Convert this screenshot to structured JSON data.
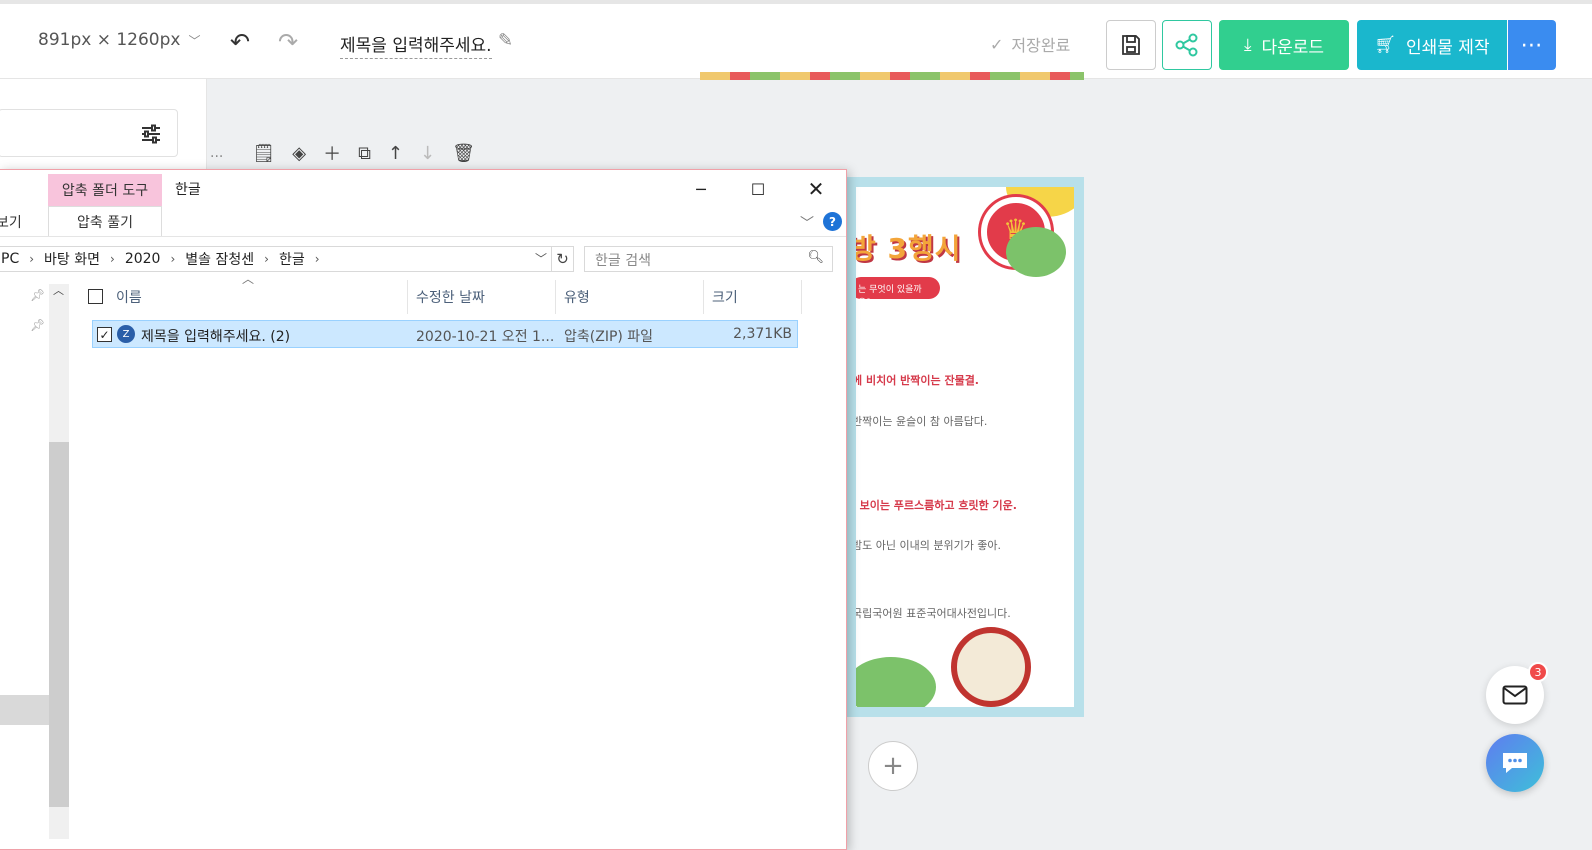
{
  "topbar": {
    "size_label": "891px × 1260px",
    "doc_title": "제목을 입력해주세요.",
    "save_status": "저장완료",
    "download_label": "다운로드",
    "print_label": "인쇄물 제작",
    "more_label": "⋯"
  },
  "canvas": {
    "toolbar_more": "...",
    "poster": {
      "title": "방 3행시",
      "tag": "는 무엇이 있을까요? ▸",
      "lines": [
        {
          "text": "에 비치어 반짝이는 잔물결.",
          "style": "red"
        },
        {
          "text": "반짝이는 윤슬이 참 아름답다.",
          "style": "gray"
        },
        {
          "text": "l 보이는 푸르스름하고 흐릿한 기운.",
          "style": "red"
        },
        {
          "text": "밤도 아닌 이내의 분위기가 좋아.",
          "style": "gray"
        },
        {
          "text": "국립국어원 표준국어대사전입니다.",
          "style": "gray"
        }
      ]
    },
    "add_page": "+"
  },
  "floating": {
    "mail_badge": "3"
  },
  "explorer": {
    "context_tab": "압축 폴더 도구",
    "window_title": "한글",
    "tabs": {
      "view": "보기",
      "extract": "압축 풀기"
    },
    "help": "?",
    "breadcrumbs": [
      "PC",
      "바탕 화면",
      "2020",
      "별솔 잠청센",
      "한글"
    ],
    "search_placeholder": "한글 검색",
    "columns": {
      "name": "이름",
      "date": "수정한 날짜",
      "type": "유형",
      "size": "크기"
    },
    "files": [
      {
        "name": "제목을 입력해주세요. (2)",
        "date": "2020-10-21 오전 1...",
        "type": "압축(ZIP) 파일",
        "size": "2,371KB",
        "checked": true,
        "selected": true
      }
    ]
  },
  "colors": {
    "download": "#31cf8f",
    "print": "#1ab7cd",
    "more": "#3a8cf0",
    "share_border": "#2fc8a0",
    "selection": "#cce8ff",
    "context_tab": "#f8c4dc"
  }
}
